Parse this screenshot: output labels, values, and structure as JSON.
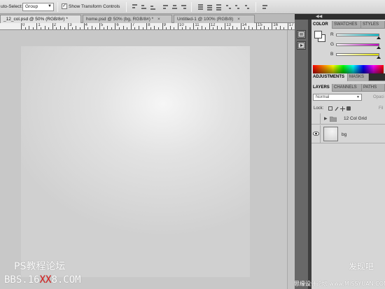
{
  "options_bar": {
    "auto_select_label": "uto-Select:",
    "auto_select_value": "Group",
    "show_transform_label": "Show Transform Controls"
  },
  "document_tabs": [
    {
      "label": "_12_col.psd @ 50% (RGB/8#) *",
      "active": true
    },
    {
      "label": "home.psd @ 50% (bg, RGB/8#) *",
      "active": false
    },
    {
      "label": "Untitled-1 @ 100% (RGB/8)",
      "active": false
    }
  ],
  "ruler_labels": [
    "0",
    "1",
    "2",
    "3",
    "4",
    "5",
    "6",
    "7",
    "8",
    "9",
    "10",
    "11",
    "12",
    "13",
    "14",
    "15",
    "16",
    "17",
    "18",
    "19"
  ],
  "color_panel": {
    "tabs": [
      "COLOR",
      "SWATCHES",
      "STYLES"
    ],
    "active_tab": "COLOR",
    "channels": [
      {
        "letter": "R",
        "color_from": "#ffffff",
        "color_to": "#00c8d8"
      },
      {
        "letter": "G",
        "color_from": "#ffffff",
        "color_to": "#c800c8"
      },
      {
        "letter": "B",
        "color_from": "#ffffff",
        "color_to": "#e0e000"
      }
    ]
  },
  "adjustments_panel": {
    "tabs": [
      "ADJUSTMENTS",
      "MASKS"
    ],
    "active_tab": "ADJUSTMENTS"
  },
  "layers_panel": {
    "tabs": [
      "LAYERS",
      "CHANNELS",
      "PATHS"
    ],
    "active_tab": "LAYERS",
    "blend_mode": "Normal",
    "opacity_label": "Opaci",
    "lock_label": "Lock:",
    "fill_label": "Fil",
    "layers": [
      {
        "name": "12 Col Grid",
        "type": "group",
        "visible": false
      },
      {
        "name": "bg",
        "type": "layer",
        "visible": true
      }
    ]
  },
  "watermarks": {
    "top_left": "PS教程论坛",
    "bottom_left_prefix": "BBS.16",
    "bottom_left_highlight": "XX",
    "bottom_left_suffix": "8.COM",
    "bottom_right_top": "发现吧",
    "bottom_right_bottom": "思缘设计论坛 www.MISSYUAN.COM"
  }
}
